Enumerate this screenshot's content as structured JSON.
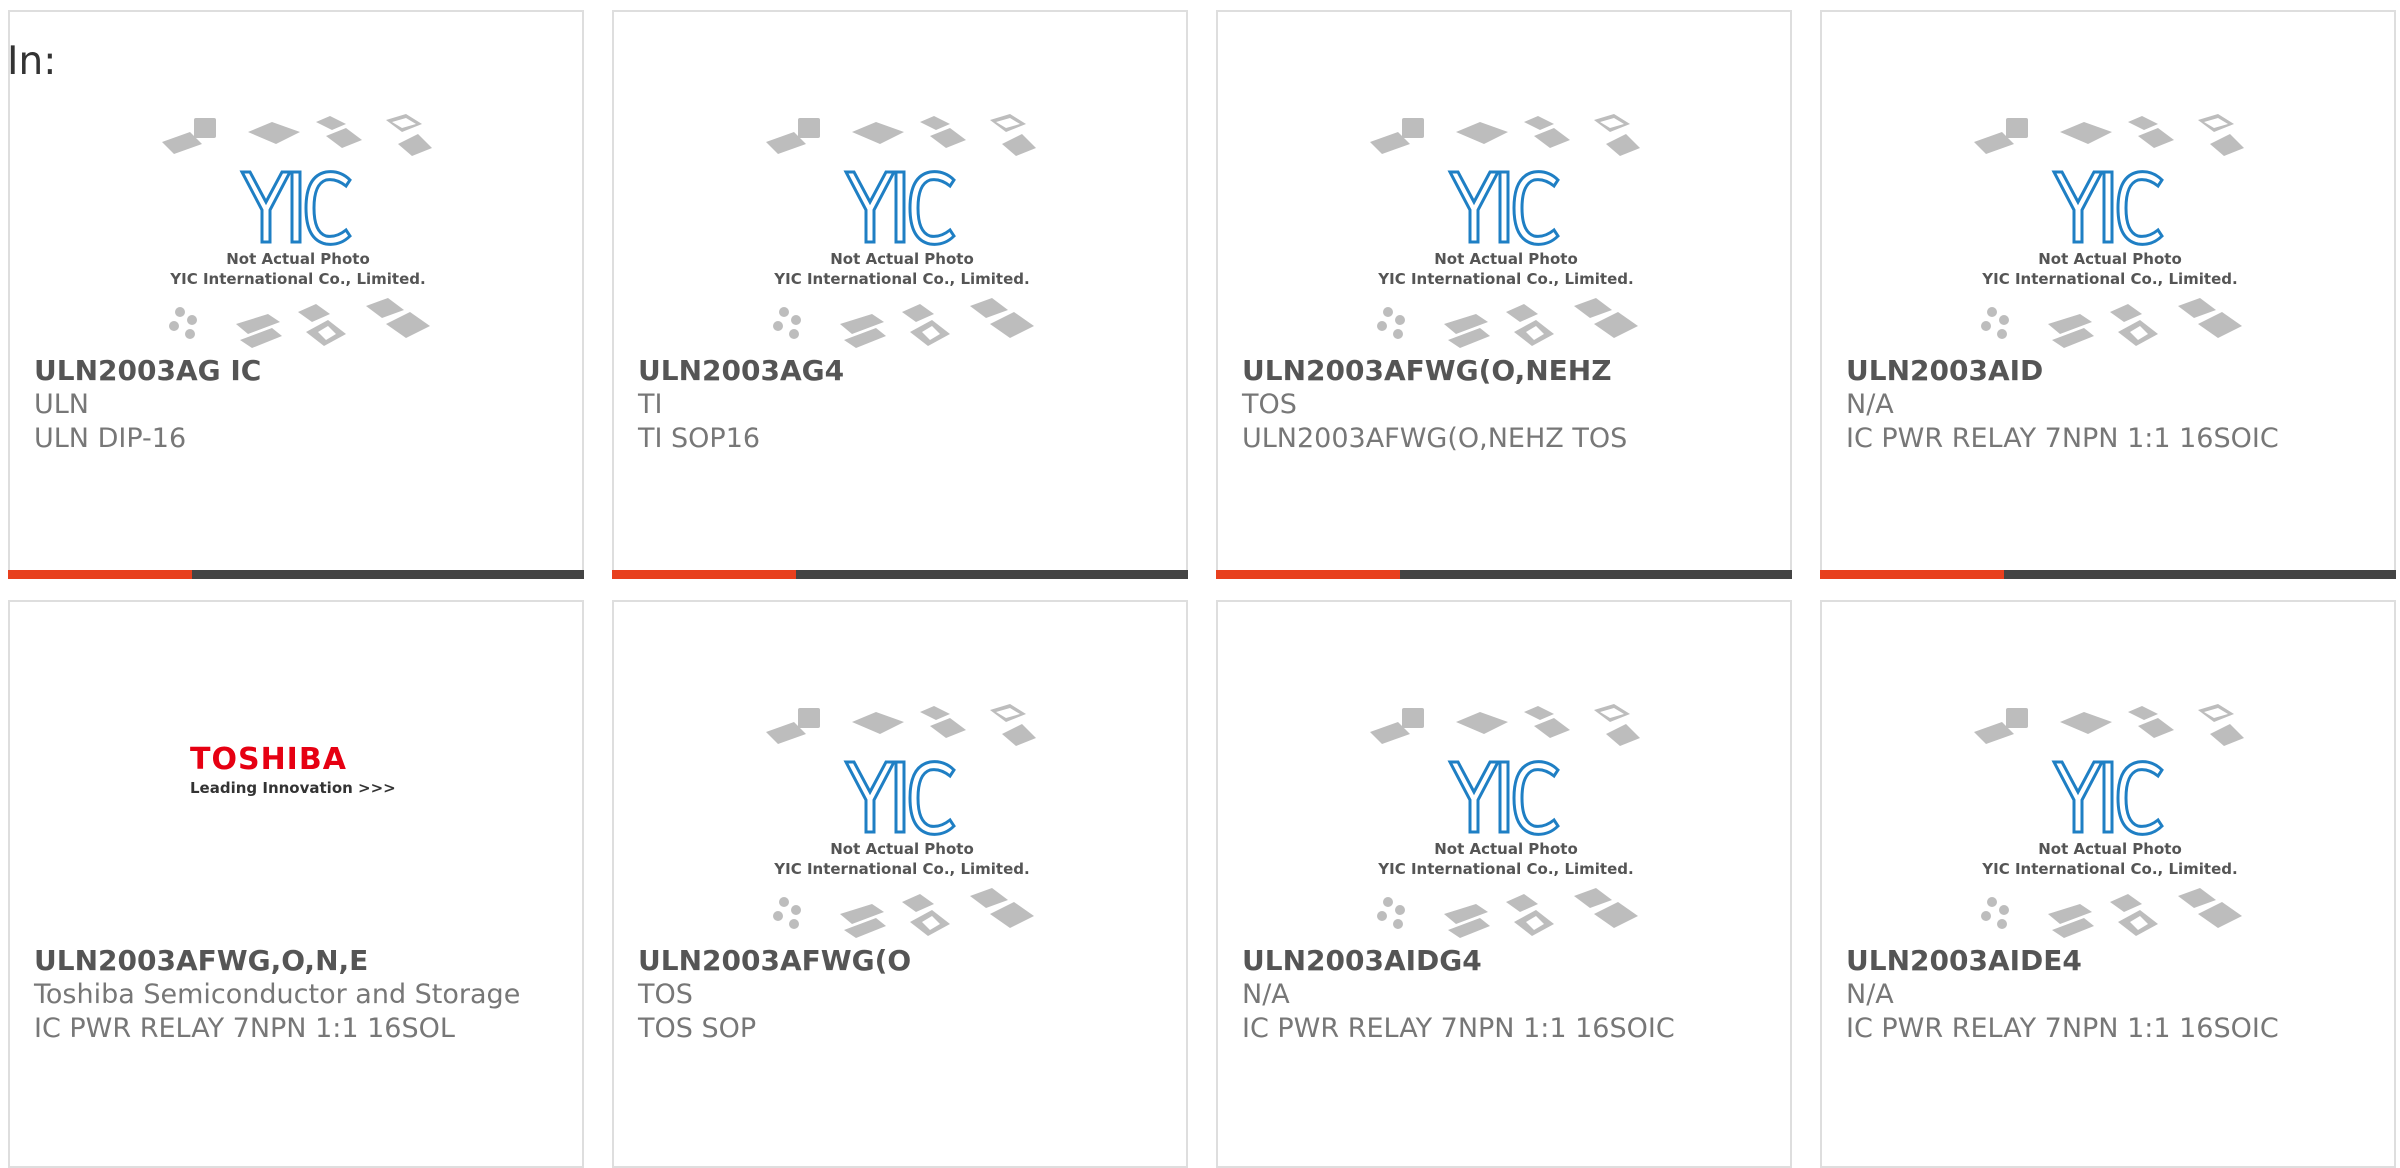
{
  "header": {
    "in_label": "In:"
  },
  "photo": {
    "line1": "Not Actual Photo",
    "line2": "YIC International Co., Limited.",
    "logo_text": "YIC"
  },
  "products": [
    {
      "part": "ULN2003AG IC",
      "manufacturer": "ULN",
      "description": "ULN DIP-16",
      "image": "yic-placeholder"
    },
    {
      "part": "ULN2003AG4",
      "manufacturer": "TI",
      "description": "TI SOP16",
      "image": "yic-placeholder"
    },
    {
      "part": "ULN2003AFWG(O,NEHZ",
      "manufacturer": "TOS",
      "description": "ULN2003AFWG(O,NEHZ TOS",
      "image": "yic-placeholder"
    },
    {
      "part": "ULN2003AID",
      "manufacturer": "N/A",
      "description": "IC PWR RELAY 7NPN 1:1 16SOIC",
      "image": "yic-placeholder"
    },
    {
      "part": "ULN2003AFWG,O,N,E",
      "manufacturer": "Toshiba Semiconductor and Storage",
      "description": "IC PWR RELAY 7NPN 1:1 16SOL",
      "image": "toshiba-logo"
    },
    {
      "part": "ULN2003AFWG(O",
      "manufacturer": "TOS",
      "description": "TOS SOP",
      "image": "yic-placeholder"
    },
    {
      "part": "ULN2003AIDG4",
      "manufacturer": "N/A",
      "description": "IC PWR RELAY 7NPN 1:1 16SOIC",
      "image": "yic-placeholder"
    },
    {
      "part": "ULN2003AIDE4",
      "manufacturer": "N/A",
      "description": "IC PWR RELAY 7NPN 1:1 16SOIC",
      "image": "yic-placeholder"
    }
  ],
  "toshiba": {
    "brand": "TOSHIBA",
    "tagline": "Leading Innovation >>>"
  },
  "colors": {
    "accent": "#e8401e",
    "bar": "#444444",
    "logo_blue": "#1f7fc4",
    "brand_red": "#e60012"
  }
}
